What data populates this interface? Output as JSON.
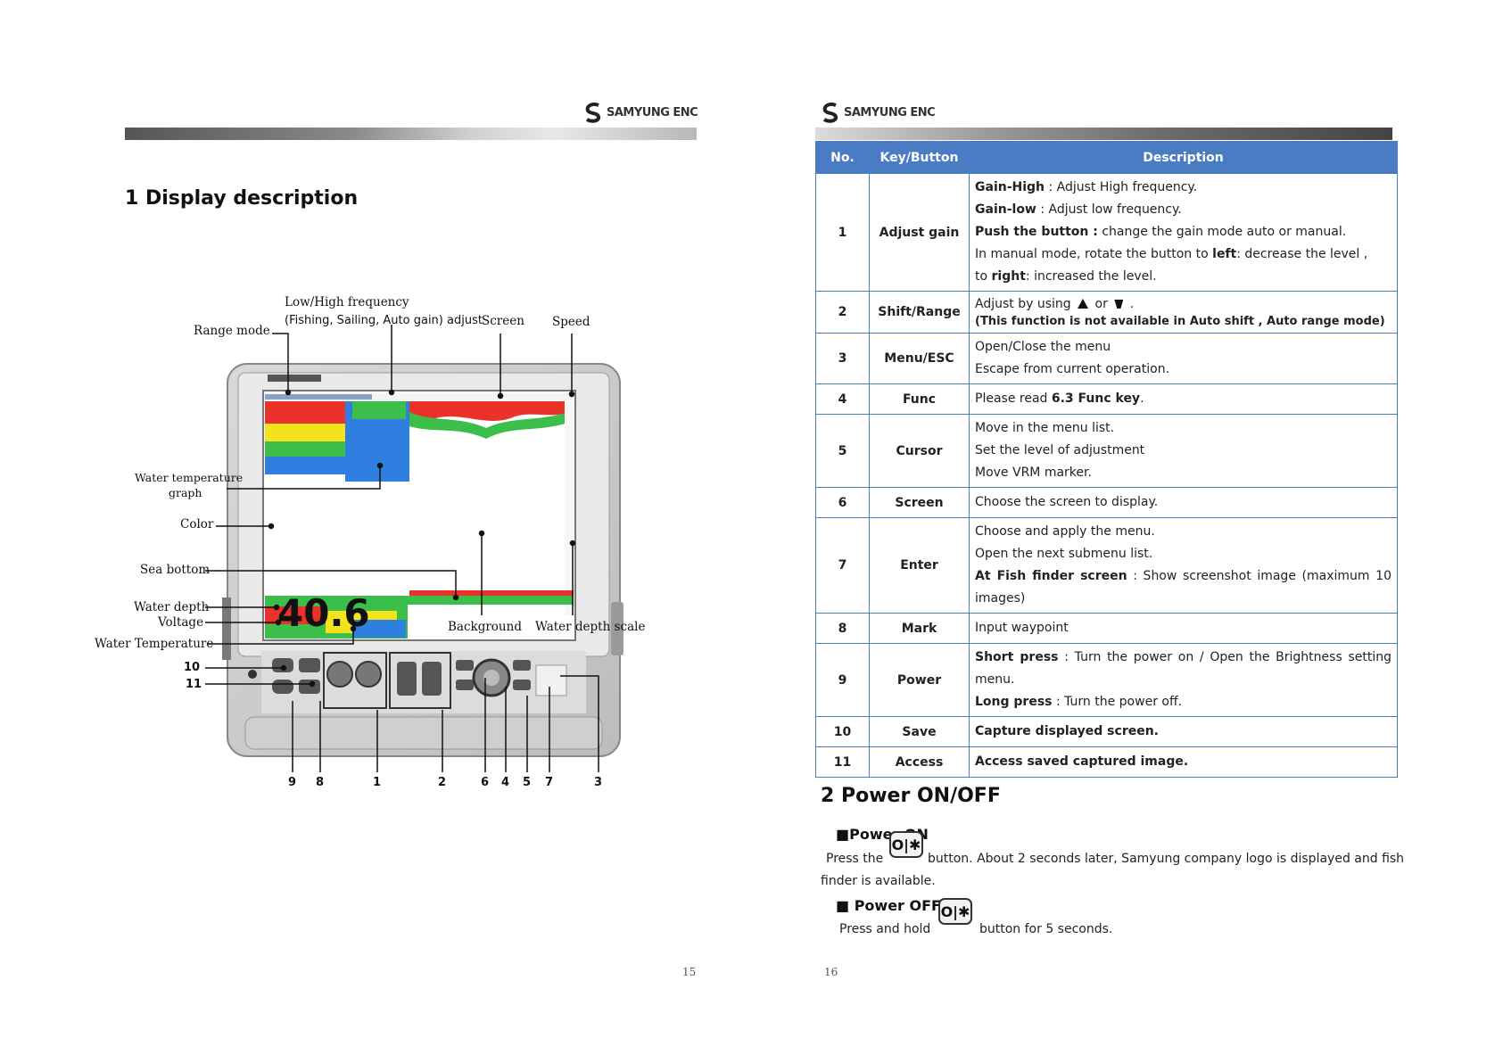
{
  "left_page": {
    "logo_text": "SAMYUNG ENC",
    "title": "1 Display description",
    "page_number": "15",
    "callouts": {
      "low_high_frequency": "Low/High frequency",
      "fishing_adjust": "(Fishing, Sailing, Auto gain) adjust",
      "screen": "Screen",
      "speed": "Speed",
      "range_mode": "Range mode",
      "water_temperature_graph_1": "Water temperature",
      "water_temperature_graph_2": "graph",
      "color": "Color",
      "sea_bottom": "Sea bottom",
      "water_depth": "Water depth",
      "voltage": "Voltage",
      "water_temperature": "Water Temperature",
      "background": "Background",
      "water_depth_scale": "Water depth scale"
    },
    "depth_readout": "40.6",
    "button_numbers": {
      "n10": "10",
      "n11": "11",
      "n9": "9",
      "n8": "8",
      "n1": "1",
      "n2": "2",
      "n6": "6",
      "n4": "4",
      "n5": "5",
      "n7": "7",
      "n3": "3"
    }
  },
  "right_page": {
    "logo_text": "SAMYUNG ENC",
    "page_number": "16",
    "table": {
      "headers": {
        "no": "No.",
        "key": "Key/Button",
        "desc": "Description"
      },
      "rows": [
        {
          "no": "1",
          "key": "Adjust gain",
          "b1": "Gain-High",
          "t1": " : Adjust High frequency.",
          "b2": "Gain-low",
          "t2": " : Adjust low frequency.",
          "b3": "Push the button :",
          "t3": " change the gain mode auto or manual.",
          "t4a": "In manual mode, rotate the button to ",
          "b4": "left",
          "t4b": ": decrease the level ,",
          "t5a": "to ",
          "b5": "right",
          "t5b": ": increased the level."
        },
        {
          "no": "2",
          "key": "Shift/Range",
          "t1a": "Adjust by using ",
          "t1b": " or ",
          "t1c": " .",
          "note": "(This function is not available in Auto shift , Auto range mode)"
        },
        {
          "no": "3",
          "key": "Menu/ESC",
          "t1": "Open/Close the menu",
          "t2": "Escape from current operation."
        },
        {
          "no": "4",
          "key": "Func",
          "t1a": "Please read ",
          "b1": "6.3 Func key",
          "t1b": "."
        },
        {
          "no": "5",
          "key": "Cursor",
          "t1": "Move in the menu list.",
          "t2": "Set the level of adjustment",
          "t3": "Move VRM marker."
        },
        {
          "no": "6",
          "key": "Screen",
          "t1": "Choose the screen to display."
        },
        {
          "no": "7",
          "key": "Enter",
          "t1": "Choose and apply the menu.",
          "t2": "Open the next submenu list.",
          "b3": "At Fish finder screen",
          "t3": " : Show screenshot image (maximum 10",
          "t4": "images)"
        },
        {
          "no": "8",
          "key": "Mark",
          "t1": "Input waypoint"
        },
        {
          "no": "9",
          "key": "Power",
          "b1": "Short press",
          "t1": " : Turn the power on / Open the Brightness setting",
          "t2": "menu.",
          "b3": "Long press",
          "t3": " : Turn the power off."
        },
        {
          "no": "10",
          "key": "Save",
          "b1": "Capture displayed screen."
        },
        {
          "no": "11",
          "key": "Access",
          "b1": "Access saved captured image."
        }
      ]
    },
    "power": {
      "title": "2 Power ON/OFF",
      "on_heading": "■Power ON",
      "on_text_a": "Press the",
      "on_text_b": "button. About 2 seconds later, Samyung company logo is displayed and fish",
      "on_text_c": "finder is available.",
      "off_heading": "■ Power OFF",
      "off_text_a": "Press and hold",
      "off_text_b": "button for 5 seconds.",
      "icon_glyph": "O|✱"
    }
  },
  "colors": {
    "table_header": "#4a7cc4",
    "table_border": "#4a7cc4",
    "sonar_red": "#e8322a",
    "sonar_yellow": "#f3e21c",
    "sonar_green": "#3bbf4a",
    "sonar_blue": "#2f7fe0"
  }
}
